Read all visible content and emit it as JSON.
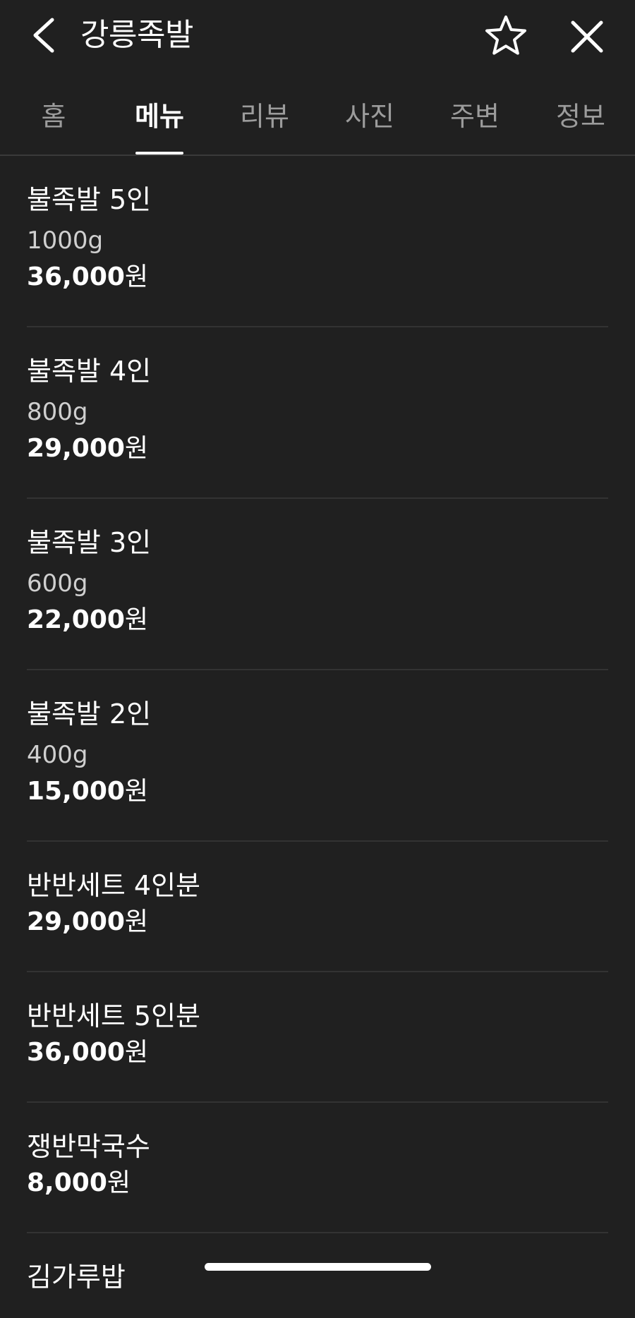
{
  "header": {
    "title": "강릉족발",
    "back_icon": "chevron-left-icon",
    "favorite_icon": "star-outline-icon",
    "close_icon": "close-icon"
  },
  "tabs": [
    {
      "label": "홈",
      "active": false
    },
    {
      "label": "메뉴",
      "active": true
    },
    {
      "label": "리뷰",
      "active": false
    },
    {
      "label": "사진",
      "active": false
    },
    {
      "label": "주변",
      "active": false
    },
    {
      "label": "정보",
      "active": false
    }
  ],
  "menu": {
    "items": [
      {
        "name": "불족발 5인",
        "weight": "1000g",
        "price": "36,000",
        "unit": "원"
      },
      {
        "name": "불족발 4인",
        "weight": "800g",
        "price": "29,000",
        "unit": "원"
      },
      {
        "name": "불족발 3인",
        "weight": "600g",
        "price": "22,000",
        "unit": "원"
      },
      {
        "name": "불족발 2인",
        "weight": "400g",
        "price": "15,000",
        "unit": "원"
      },
      {
        "name": "반반세트 4인분",
        "price": "29,000",
        "unit": "원"
      },
      {
        "name": "반반세트 5인분",
        "price": "36,000",
        "unit": "원"
      },
      {
        "name": "쟁반막국수",
        "price": "8,000",
        "unit": "원"
      },
      {
        "name": "김가루밥"
      }
    ]
  },
  "colors": {
    "background": "#202020",
    "text": "#ffffff",
    "tab_inactive": "#9c9c9c",
    "divider": "#333333"
  }
}
